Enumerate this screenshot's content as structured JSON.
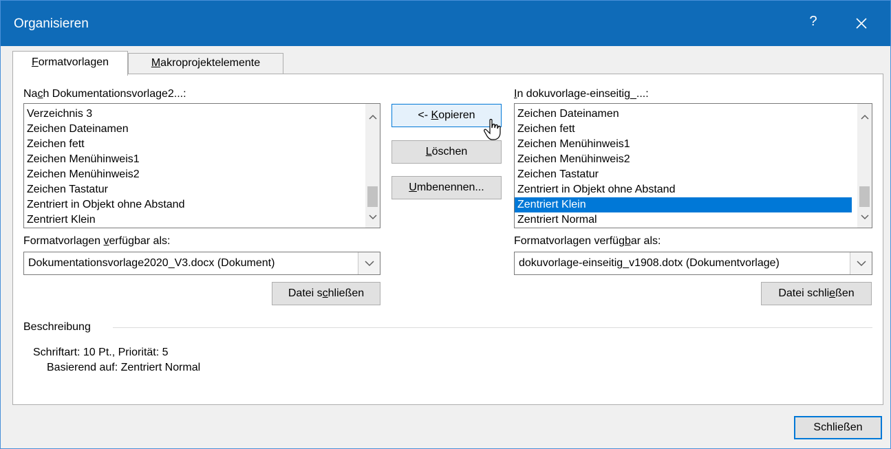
{
  "window": {
    "title": "Organisieren",
    "help_label": "?",
    "close_icon": "close-icon"
  },
  "tabs": [
    {
      "label_pre": "",
      "label_key": "F",
      "label_post": "ormatvorlagen"
    },
    {
      "label_pre": "",
      "label_key": "M",
      "label_post": "akroprojektelemente"
    }
  ],
  "left": {
    "label_pre": "Na",
    "label_key": "c",
    "label_post": "h Dokumentationsvorlage2...:",
    "items": [
      "Verzeichnis 3",
      "Zeichen Dateinamen",
      "Zeichen fett",
      "Zeichen Menühinweis1",
      "Zeichen Menühinweis2",
      "Zeichen Tastatur",
      "Zentriert in Objekt ohne Abstand",
      "Zentriert Klein"
    ],
    "available_pre": "Formatvorlagen ",
    "available_key": "v",
    "available_post": "erfügbar als:",
    "combo_value": "Dokumentationsvorlage2020_V3.docx (Dokument)",
    "close_file_pre": "Datei s",
    "close_file_key": "c",
    "close_file_post": "hließen"
  },
  "right": {
    "label_pre": "",
    "label_key": "I",
    "label_post": "n dokuvorlage-einseitig_...:",
    "items": [
      "Zeichen Dateinamen",
      "Zeichen fett",
      "Zeichen Menühinweis1",
      "Zeichen Menühinweis2",
      "Zeichen Tastatur",
      "Zentriert in Objekt ohne Abstand",
      "Zentriert Klein",
      "Zentriert Normal"
    ],
    "selected": "Zentriert Klein",
    "available_pre": "Formatvorlagen verfüg",
    "available_key": "b",
    "available_post": "ar als:",
    "combo_value": "dokuvorlage-einseitig_v1908.dotx (Dokumentvorlage)",
    "close_file_pre": "Datei schli",
    "close_file_key": "e",
    "close_file_post": "ßen"
  },
  "middle": {
    "copy_pre": "<- ",
    "copy_key": "K",
    "copy_post": "opieren",
    "delete_pre": "",
    "delete_key": "L",
    "delete_post": "öschen",
    "rename_pre": "",
    "rename_key": "U",
    "rename_post": "mbenennen..."
  },
  "description": {
    "heading": "Beschreibung",
    "line1": "Schriftart: 10 Pt., Priorität: 5",
    "line2": "Basierend auf: Zentriert Normal"
  },
  "footer": {
    "close_label": "Schließen"
  },
  "colors": {
    "titlebar": "#0f6bb8",
    "selection": "#0078d7",
    "focus_border": "#0078d7"
  }
}
